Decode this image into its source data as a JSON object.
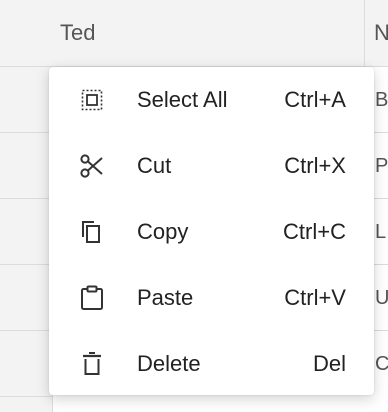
{
  "grid": {
    "header_cells": [
      "Ted",
      "N"
    ],
    "peek_letters": [
      "B",
      "P",
      "L",
      "U",
      "C"
    ]
  },
  "context_menu": {
    "items": [
      {
        "label": "Select All",
        "shortcut": "Ctrl+A",
        "icon": "select-all-icon"
      },
      {
        "label": "Cut",
        "shortcut": "Ctrl+X",
        "icon": "scissors-icon"
      },
      {
        "label": "Copy",
        "shortcut": "Ctrl+C",
        "icon": "copy-icon"
      },
      {
        "label": "Paste",
        "shortcut": "Ctrl+V",
        "icon": "clipboard-icon"
      },
      {
        "label": "Delete",
        "shortcut": "Del",
        "icon": "trash-icon"
      }
    ]
  }
}
